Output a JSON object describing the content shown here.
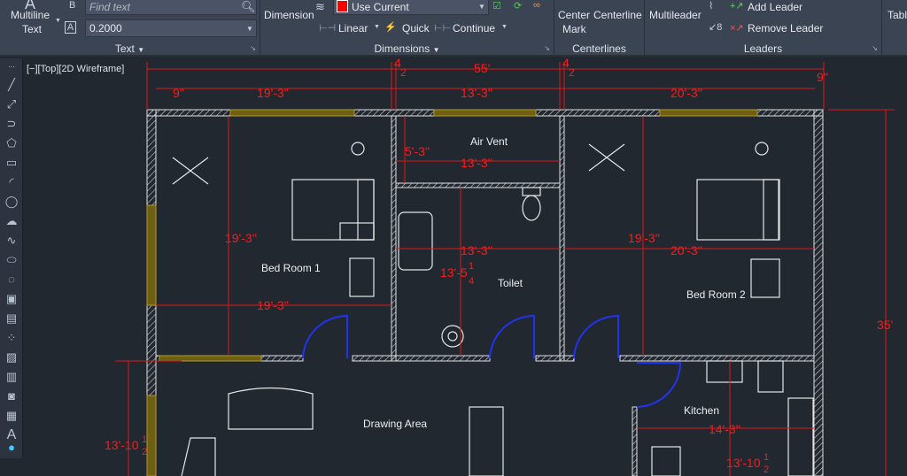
{
  "ribbon": {
    "text_panel": {
      "multiline_text": "Multiline",
      "multiline_text2": "Text",
      "find_placeholder": "Find text",
      "height_value": "0.2000",
      "title": "Text"
    },
    "dimensions_panel": {
      "dimension": "Dimension",
      "layer_value": "Use Current",
      "layer_color": "#ff0000",
      "linear": "Linear",
      "quick": "Quick",
      "continue": "Continue",
      "title": "Dimensions"
    },
    "centerlines_panel": {
      "center_mark": "Center",
      "center_mark2": "Mark",
      "centerline": "Centerline",
      "title": "Centerlines"
    },
    "leaders_panel": {
      "multileader": "Multileader",
      "add_leader": "Add Leader",
      "remove_leader": "Remove Leader",
      "title": "Leaders"
    },
    "table_panel": {
      "table": "Tabl"
    }
  },
  "viewport": {
    "label": "[−][Top][2D Wireframe]"
  },
  "drawing": {
    "rooms": {
      "bed1": "Bed Room 1",
      "air_vent": "Air Vent",
      "toilet": "Toilet",
      "bed2": "Bed Room 2",
      "drawing_area": "Drawing Area",
      "kitchen": "Kitchen"
    },
    "dims": {
      "d_9a": "9''",
      "d_19_3a": "19'-3''",
      "d_4_half_a": "4",
      "d_55": "55'",
      "d_13_3a": "13'-3''",
      "d_4_half_b": "4",
      "d_20_3a": "20'-3''",
      "d_9b": "9''",
      "d_19_3_v": "19'-3''",
      "d_19_3b": "19'-3''",
      "d_5_3": "5'-3''",
      "d_13_3b": "13'-3''",
      "d_13_3c": "13'-3''",
      "d_13_5": "13'-5",
      "d_19_3_v2": "19'-3''",
      "d_20_3b": "20'-3''",
      "d_35": "35'",
      "d_13_10a": "13'-10",
      "d_14_3": "14'-3''",
      "d_13_10b": "13'-10",
      "frac_num": "1",
      "frac_den": "2",
      "frac_den4": "4",
      "inch": "''"
    },
    "colors": {
      "dim": "#ff1a1a",
      "wall": "#e0e0e0",
      "window": "#8c7a1e",
      "door": "#1f2fe0"
    }
  }
}
